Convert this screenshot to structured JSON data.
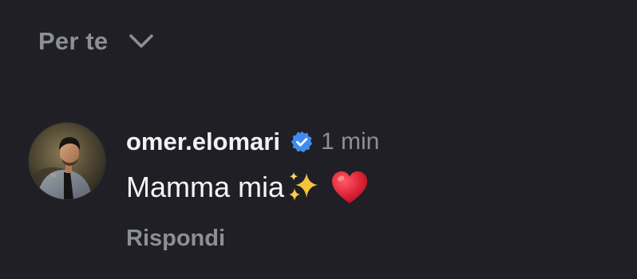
{
  "filter": {
    "label": "Per te",
    "icon": "chevron-down-icon"
  },
  "comment": {
    "avatar_icon": "user-avatar",
    "username": "omer.elomari",
    "verified_icon": "verified-badge-icon",
    "verified_color": "#3f8cf0",
    "time": "1 min",
    "text": "Mamma mia",
    "emojis": [
      "sparkles-emoji",
      "red-heart-emoji"
    ],
    "reply_label": "Rispondi"
  },
  "colors": {
    "background": "#1f1f25",
    "primary_text": "#f2f2f4",
    "secondary_text": "#8d8f98",
    "heart": "#e0243a",
    "sparkle": "#f5c43a"
  }
}
